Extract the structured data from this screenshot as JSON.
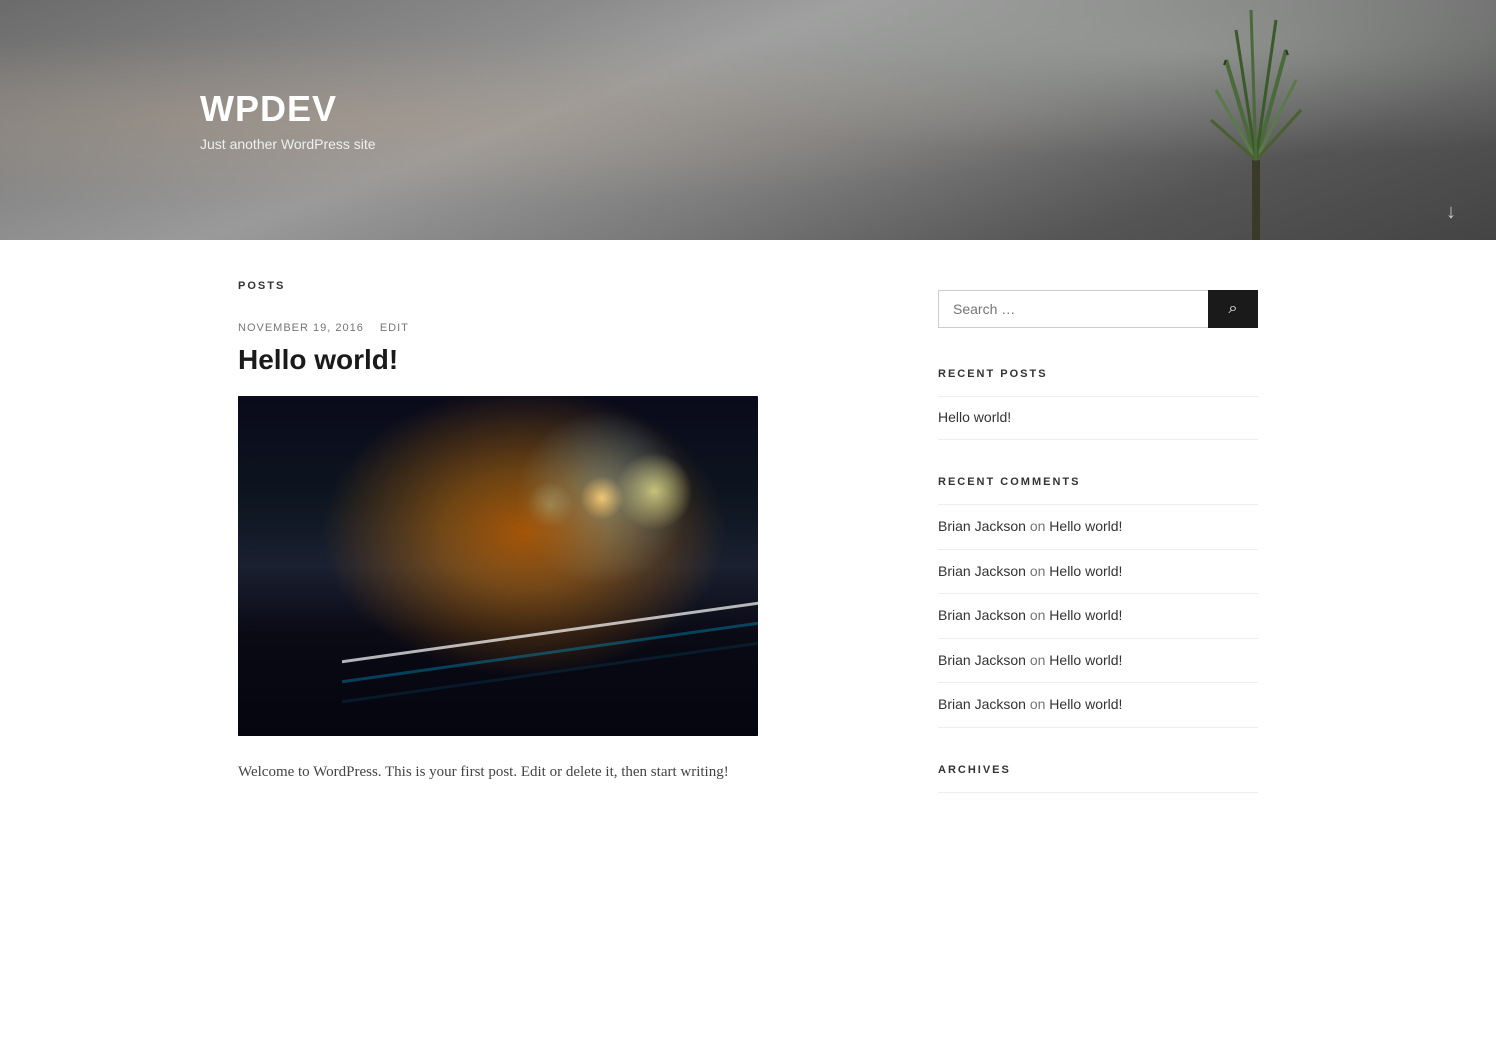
{
  "site": {
    "title": "WPDEV",
    "tagline": "Just another WordPress site"
  },
  "header": {
    "scroll_down_label": "↓"
  },
  "posts_section": {
    "label": "POSTS"
  },
  "post": {
    "date": "NOVEMBER 19, 2016",
    "edit_label": "EDIT",
    "title": "Hello world!",
    "excerpt": "Welcome to WordPress. This is your first post. Edit or delete it, then start writing!"
  },
  "sidebar": {
    "search": {
      "placeholder": "Search …",
      "button_label": "Search",
      "button_icon": "🔍"
    },
    "recent_posts": {
      "title": "RECENT POSTS",
      "items": [
        {
          "label": "Hello world!"
        }
      ]
    },
    "recent_comments": {
      "title": "RECENT COMMENTS",
      "items": [
        {
          "author": "Brian Jackson",
          "on": "on",
          "post": "Hello world!"
        },
        {
          "author": "Brian Jackson",
          "on": "on",
          "post": "Hello world!"
        },
        {
          "author": "Brian Jackson",
          "on": "on",
          "post": "Hello world!"
        },
        {
          "author": "Brian Jackson",
          "on": "on",
          "post": "Hello world!"
        },
        {
          "author": "Brian Jackson",
          "on": "on",
          "post": "Hello world!"
        }
      ]
    },
    "archives": {
      "title": "ARCHIVES"
    }
  }
}
